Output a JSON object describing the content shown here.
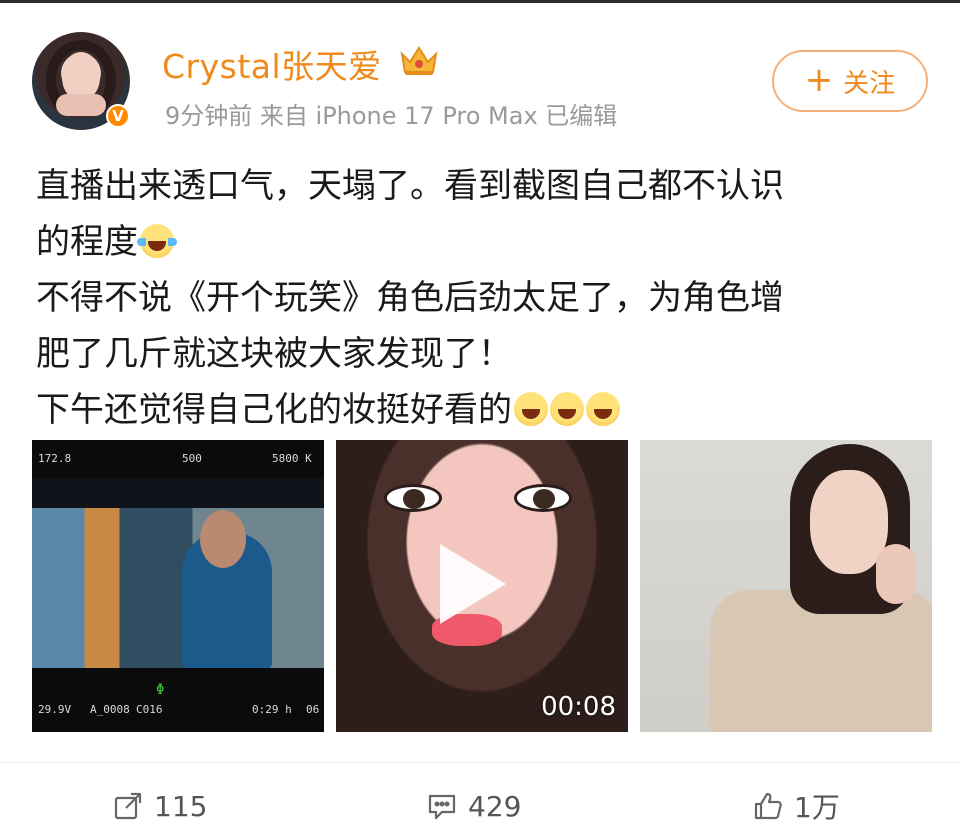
{
  "post": {
    "author": {
      "name": "Crystal张天爱",
      "verified_badge": "v-badge",
      "crown_icon": "crown-icon"
    },
    "meta": "9分钟前  来自 iPhone 17 Pro Max 已编辑",
    "follow_button": {
      "icon": "+",
      "label": "关注"
    },
    "text_lines": [
      "直播出来透口气，天塌了。看到截图自己都不认识",
      "的程度",
      "不得不说《开个玩笑》角色后劲太足了，为角色增",
      "肥了几斤就这块被大家发现了！",
      "下午还觉得自己化的妆挺好看的"
    ],
    "media": [
      {
        "type": "image",
        "monitor_overlay": {
          "top_left": "172.8",
          "top_mid": "500",
          "top_right": "5800 K",
          "bottom_left": "29.9V",
          "bottom_clip": "A_0008",
          "bottom_cam": "C016",
          "bottom_right": "0:29 h",
          "bottom_far": "06"
        }
      },
      {
        "type": "video",
        "duration": "00:08"
      },
      {
        "type": "image"
      }
    ],
    "actions": {
      "repost_count": "115",
      "comment_count": "429",
      "like_count": "1万"
    }
  },
  "colors": {
    "brand_orange": "#f08a1c",
    "follow_border": "#f4b07a",
    "meta_gray": "#9a9a9a"
  }
}
